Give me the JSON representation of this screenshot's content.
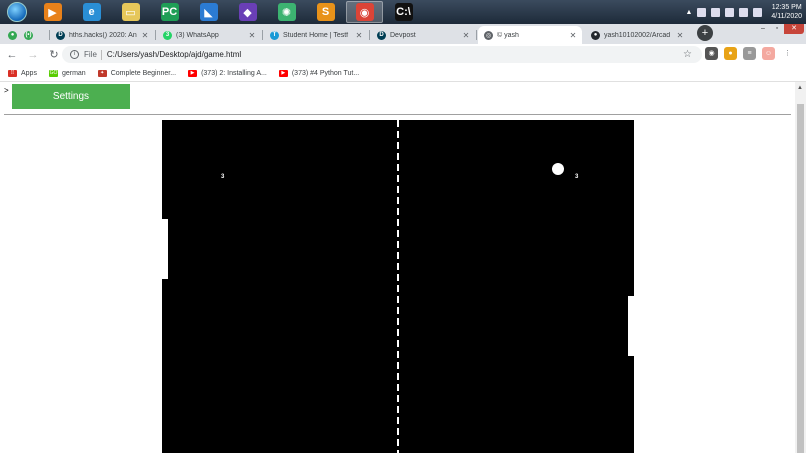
{
  "taskbar": {
    "apps": [
      {
        "icon": "media-player-icon",
        "glyph": "▶",
        "color": "#e8811a"
      },
      {
        "icon": "internet-explorer-icon",
        "glyph": "e",
        "color": "#2a8fd6"
      },
      {
        "icon": "file-explorer-icon",
        "glyph": "▭",
        "color": "#e6c75a"
      },
      {
        "icon": "pycharm-icon",
        "glyph": "PC",
        "color": "#1f9e56"
      },
      {
        "icon": "vscode-icon",
        "glyph": "◣",
        "color": "#2b7bd3"
      },
      {
        "icon": "visual-studio-icon",
        "glyph": "◆",
        "color": "#6a3fb6"
      },
      {
        "icon": "atom-icon",
        "glyph": "✺",
        "color": "#3cb371"
      },
      {
        "icon": "sublime-text-icon",
        "glyph": "S",
        "color": "#e8921a"
      },
      {
        "icon": "chrome-icon",
        "glyph": "◉",
        "color": "#db4437"
      },
      {
        "icon": "command-prompt-icon",
        "glyph": "C:\\",
        "color": "#111111"
      }
    ],
    "time": "12:35 PM",
    "date": "4/11/2020"
  },
  "tabs": [
    {
      "title": "",
      "favicon": "map-pin-icon",
      "fav_color": "#34a853",
      "fav_glyph": "●"
    },
    {
      "title": "",
      "favicon": "bracket-icon",
      "fav_color": "#34a853",
      "fav_glyph": "(•)"
    },
    {
      "title": "hths.hacks() 2020: An",
      "favicon": "devpost-icon",
      "fav_color": "#003e54",
      "fav_glyph": "D"
    },
    {
      "title": "(3) WhatsApp",
      "favicon": "whatsapp-icon",
      "fav_color": "#25d366",
      "fav_glyph": "3"
    },
    {
      "title": "Student Home | Testf",
      "favicon": "testfirst-icon",
      "fav_color": "#1a9ad6",
      "fav_glyph": "T"
    },
    {
      "title": "Devpost",
      "favicon": "devpost-icon",
      "fav_color": "#003e54",
      "fav_glyph": "D"
    },
    {
      "title": "© yash",
      "favicon": "globe-icon",
      "fav_color": "#5f6368",
      "fav_glyph": "◎"
    },
    {
      "title": "yash10102002/Arcad",
      "favicon": "github-icon",
      "fav_color": "#24292e",
      "fav_glyph": "●"
    }
  ],
  "address": {
    "scheme": "File",
    "url": "C:/Users/yash/Desktop/ajd/game.html"
  },
  "bookmarks": [
    {
      "label": "Apps",
      "icon": "apps-grid-icon",
      "color": "#d93025",
      "glyph": "⠿"
    },
    {
      "label": "german",
      "icon": "duolingo-icon",
      "color": "#58cc02",
      "glyph": "GO"
    },
    {
      "label": "Complete Beginner...",
      "icon": "tryhackme-icon",
      "color": "#c0392b",
      "glyph": "✦"
    },
    {
      "label": "(373) 2: Installing A...",
      "icon": "youtube-icon",
      "color": "#ff0000",
      "glyph": "▶"
    },
    {
      "label": "(373) #4 Python Tut...",
      "icon": "youtube-icon",
      "color": "#ff0000",
      "glyph": "▶"
    }
  ],
  "page": {
    "caret": ">",
    "settings_label": "Settings"
  },
  "game": {
    "score_left": "3",
    "score_right": "3"
  }
}
